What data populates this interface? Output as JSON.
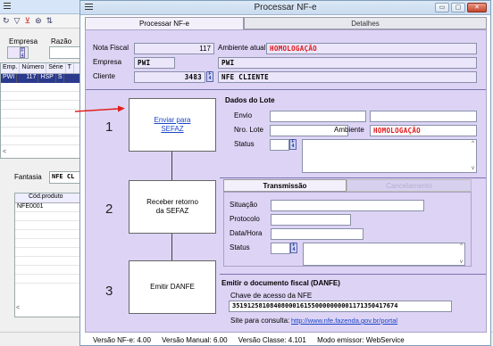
{
  "background_window": {
    "toolbar_icons": [
      "refresh-icon",
      "filter-icon",
      "clear-filter-icon",
      "binoculars-icon",
      "sort-icon"
    ],
    "toolbar_glyphs": [
      "↻",
      "▽",
      "⊻",
      "⊛",
      "⇅"
    ],
    "empresa_label": "Empresa",
    "razao_label": "Razão",
    "grid_headers": [
      "Emp.",
      "Número",
      "Série",
      "T"
    ],
    "grid_row": [
      "PWI",
      "117",
      "HSP",
      "S"
    ],
    "fantasia_label": "Fantasia",
    "fantasia_value": "NFE CL",
    "product_header": "Cód.produto",
    "product_cell": "NFE0001"
  },
  "dialog": {
    "title": "Processar NF-e",
    "tabs": [
      "Processar NF-e",
      "Detalhes"
    ],
    "window_buttons": {
      "minimize": "▭",
      "maximize": "▢",
      "close": "✕"
    },
    "nota_fiscal_label": "Nota Fiscal",
    "nota_fiscal_value": "117",
    "ambiente_atual_label": "Ambiente atual",
    "ambiente_atual_value": "HOMOLOGAÇÃO",
    "empresa_label": "Empresa",
    "empresa_code": "PWI",
    "empresa_name": "PWI",
    "cliente_label": "Cliente",
    "cliente_code": "3483",
    "cliente_name": "NFE CLIENTE",
    "steps": [
      {
        "number": "1",
        "text_line1": "Enviar para",
        "text_line2": "SEFAZ"
      },
      {
        "number": "2",
        "text_line1": "Receber retorno",
        "text_line2": "da SEFAZ"
      },
      {
        "number": "3",
        "text_line1": "Emitir DANFE",
        "text_line2": ""
      }
    ],
    "lote": {
      "title": "Dados do Lote",
      "envio_label": "Envio",
      "nro_lote_label": "Nro. Lote",
      "ambiente_label": "Ambiente",
      "ambiente_value": "HOMOLOGAÇÃO",
      "status_label": "Status"
    },
    "transmissao_tabs": [
      "Transmissão",
      "Cancelamento"
    ],
    "transmissao": {
      "situacao_label": "Situação",
      "protocolo_label": "Protocolo",
      "data_hora_label": "Data/Hora",
      "status_label": "Status"
    },
    "danfe": {
      "title": "Emitir o documento fiscal (DANFE)",
      "chave_label": "Chave de acesso da NFE",
      "chave_value": "35191258108408000161550000000001171350417674",
      "consulta_label": "Site para consulta:",
      "consulta_link": "http://www.nfe.fazenda.gov.br/portal"
    },
    "footer": {
      "versao_nfe": "Versão NF-e: 4.00",
      "versao_manual": "Versão Manual: 6.00",
      "versao_classe": "Versão Classe: 4.101",
      "modo_emissor": "Modo emissor: WebService"
    }
  },
  "colors": {
    "panel": "#ddd4f5",
    "warning_red": "#e01818",
    "link_blue": "#1b45c8",
    "arrow_red": "#e02020"
  }
}
